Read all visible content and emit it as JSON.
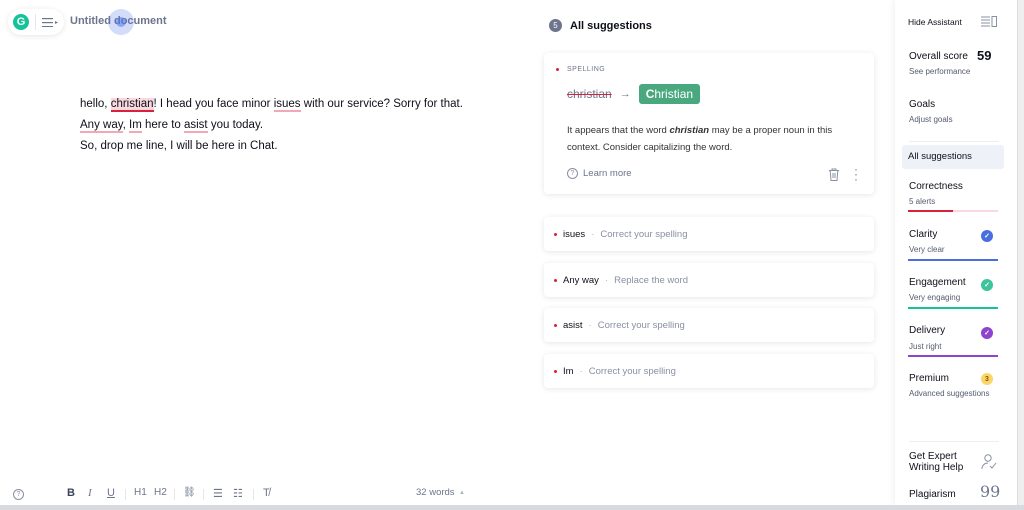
{
  "header": {
    "doc_title": "Untitled document",
    "logo_letter": "G"
  },
  "editor": {
    "line1": {
      "pre": "hello, ",
      "w1": "christian",
      "mid": "! I head you face minor ",
      "w2": "isues",
      "post": " with our service? Sorry for that."
    },
    "line2": {
      "w1": "Any way",
      "mid1": ", ",
      "w2": "Im",
      "mid2": " here to ",
      "w3": "asist",
      "post": " you today."
    },
    "line3": "So, drop me line, I will be here in Chat."
  },
  "toolbar": {
    "help": "?",
    "bold": "B",
    "italic": "I",
    "underline": "U",
    "h1": "H1",
    "h2": "H2",
    "link": "⛓",
    "ordered_list": "☰",
    "bullet_list": "☷",
    "clear_format": "T̸",
    "word_count": "32 words",
    "word_count_caret": "▲"
  },
  "suggestions": {
    "count": "5",
    "title": "All suggestions",
    "active": {
      "category": "SPELLING",
      "original": "christian",
      "arrow": "→",
      "fix_first": "C",
      "fix_rest": "hristian",
      "explain_pre": "It appears that the word ",
      "explain_word": "christian",
      "explain_post": " may be a proper noun in this context. Consider capitalizing the word.",
      "learn_more": "Learn more"
    },
    "items": [
      {
        "word": "isues",
        "hint": "Correct your spelling"
      },
      {
        "word": "Any way",
        "hint": "Replace the word"
      },
      {
        "word": "asist",
        "hint": "Correct your spelling"
      },
      {
        "word": "Im",
        "hint": "Correct your spelling"
      }
    ],
    "separator": "·"
  },
  "sidebar": {
    "hide_assistant": "Hide Assistant",
    "overall_score_label": "Overall score",
    "overall_score": "59",
    "see_performance": "See performance",
    "goals": "Goals",
    "adjust_goals": "Adjust goals",
    "all_suggestions": "All suggestions",
    "categories": [
      {
        "name": "Correctness",
        "status": "5 alerts",
        "color": "#d8213b",
        "progress": 0.5
      },
      {
        "name": "Clarity",
        "status": "Very clear",
        "color": "#4a6ee0",
        "progress": 1.0
      },
      {
        "name": "Engagement",
        "status": "Very engaging",
        "color": "#15c39a",
        "progress": 1.0
      },
      {
        "name": "Delivery",
        "status": "Just right",
        "color": "#8e44cc",
        "progress": 1.0
      }
    ],
    "premium": "Premium",
    "premium_count": "3",
    "premium_sub": "Advanced suggestions",
    "expert_help_line1": "Get Expert",
    "expert_help_line2": "Writing Help",
    "plagiarism": "Plagiarism"
  },
  "colors": {
    "accent_green": "#15c39a",
    "fix_button": "#4aa87f",
    "alert_red": "#d8213b"
  }
}
